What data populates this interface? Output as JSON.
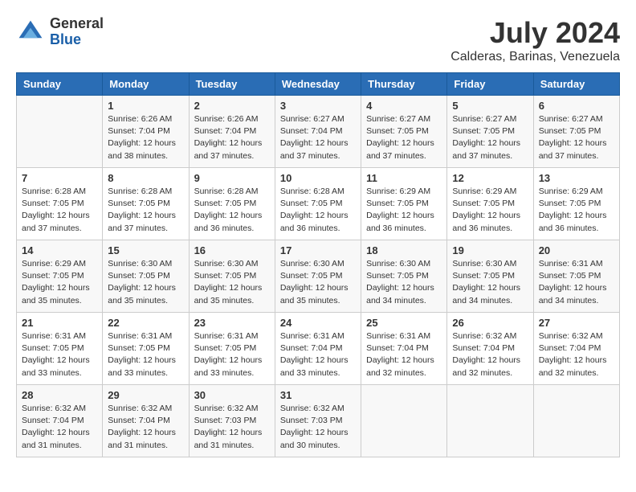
{
  "header": {
    "logo_general": "General",
    "logo_blue": "Blue",
    "title": "July 2024",
    "location": "Calderas, Barinas, Venezuela"
  },
  "days_of_week": [
    "Sunday",
    "Monday",
    "Tuesday",
    "Wednesday",
    "Thursday",
    "Friday",
    "Saturday"
  ],
  "weeks": [
    [
      {
        "day": "",
        "info": ""
      },
      {
        "day": "1",
        "info": "Sunrise: 6:26 AM\nSunset: 7:04 PM\nDaylight: 12 hours\nand 38 minutes."
      },
      {
        "day": "2",
        "info": "Sunrise: 6:26 AM\nSunset: 7:04 PM\nDaylight: 12 hours\nand 37 minutes."
      },
      {
        "day": "3",
        "info": "Sunrise: 6:27 AM\nSunset: 7:04 PM\nDaylight: 12 hours\nand 37 minutes."
      },
      {
        "day": "4",
        "info": "Sunrise: 6:27 AM\nSunset: 7:05 PM\nDaylight: 12 hours\nand 37 minutes."
      },
      {
        "day": "5",
        "info": "Sunrise: 6:27 AM\nSunset: 7:05 PM\nDaylight: 12 hours\nand 37 minutes."
      },
      {
        "day": "6",
        "info": "Sunrise: 6:27 AM\nSunset: 7:05 PM\nDaylight: 12 hours\nand 37 minutes."
      }
    ],
    [
      {
        "day": "7",
        "info": "Sunrise: 6:28 AM\nSunset: 7:05 PM\nDaylight: 12 hours\nand 37 minutes."
      },
      {
        "day": "8",
        "info": "Sunrise: 6:28 AM\nSunset: 7:05 PM\nDaylight: 12 hours\nand 37 minutes."
      },
      {
        "day": "9",
        "info": "Sunrise: 6:28 AM\nSunset: 7:05 PM\nDaylight: 12 hours\nand 36 minutes."
      },
      {
        "day": "10",
        "info": "Sunrise: 6:28 AM\nSunset: 7:05 PM\nDaylight: 12 hours\nand 36 minutes."
      },
      {
        "day": "11",
        "info": "Sunrise: 6:29 AM\nSunset: 7:05 PM\nDaylight: 12 hours\nand 36 minutes."
      },
      {
        "day": "12",
        "info": "Sunrise: 6:29 AM\nSunset: 7:05 PM\nDaylight: 12 hours\nand 36 minutes."
      },
      {
        "day": "13",
        "info": "Sunrise: 6:29 AM\nSunset: 7:05 PM\nDaylight: 12 hours\nand 36 minutes."
      }
    ],
    [
      {
        "day": "14",
        "info": "Sunrise: 6:29 AM\nSunset: 7:05 PM\nDaylight: 12 hours\nand 35 minutes."
      },
      {
        "day": "15",
        "info": "Sunrise: 6:30 AM\nSunset: 7:05 PM\nDaylight: 12 hours\nand 35 minutes."
      },
      {
        "day": "16",
        "info": "Sunrise: 6:30 AM\nSunset: 7:05 PM\nDaylight: 12 hours\nand 35 minutes."
      },
      {
        "day": "17",
        "info": "Sunrise: 6:30 AM\nSunset: 7:05 PM\nDaylight: 12 hours\nand 35 minutes."
      },
      {
        "day": "18",
        "info": "Sunrise: 6:30 AM\nSunset: 7:05 PM\nDaylight: 12 hours\nand 34 minutes."
      },
      {
        "day": "19",
        "info": "Sunrise: 6:30 AM\nSunset: 7:05 PM\nDaylight: 12 hours\nand 34 minutes."
      },
      {
        "day": "20",
        "info": "Sunrise: 6:31 AM\nSunset: 7:05 PM\nDaylight: 12 hours\nand 34 minutes."
      }
    ],
    [
      {
        "day": "21",
        "info": "Sunrise: 6:31 AM\nSunset: 7:05 PM\nDaylight: 12 hours\nand 33 minutes."
      },
      {
        "day": "22",
        "info": "Sunrise: 6:31 AM\nSunset: 7:05 PM\nDaylight: 12 hours\nand 33 minutes."
      },
      {
        "day": "23",
        "info": "Sunrise: 6:31 AM\nSunset: 7:05 PM\nDaylight: 12 hours\nand 33 minutes."
      },
      {
        "day": "24",
        "info": "Sunrise: 6:31 AM\nSunset: 7:04 PM\nDaylight: 12 hours\nand 33 minutes."
      },
      {
        "day": "25",
        "info": "Sunrise: 6:31 AM\nSunset: 7:04 PM\nDaylight: 12 hours\nand 32 minutes."
      },
      {
        "day": "26",
        "info": "Sunrise: 6:32 AM\nSunset: 7:04 PM\nDaylight: 12 hours\nand 32 minutes."
      },
      {
        "day": "27",
        "info": "Sunrise: 6:32 AM\nSunset: 7:04 PM\nDaylight: 12 hours\nand 32 minutes."
      }
    ],
    [
      {
        "day": "28",
        "info": "Sunrise: 6:32 AM\nSunset: 7:04 PM\nDaylight: 12 hours\nand 31 minutes."
      },
      {
        "day": "29",
        "info": "Sunrise: 6:32 AM\nSunset: 7:04 PM\nDaylight: 12 hours\nand 31 minutes."
      },
      {
        "day": "30",
        "info": "Sunrise: 6:32 AM\nSunset: 7:03 PM\nDaylight: 12 hours\nand 31 minutes."
      },
      {
        "day": "31",
        "info": "Sunrise: 6:32 AM\nSunset: 7:03 PM\nDaylight: 12 hours\nand 30 minutes."
      },
      {
        "day": "",
        "info": ""
      },
      {
        "day": "",
        "info": ""
      },
      {
        "day": "",
        "info": ""
      }
    ]
  ]
}
